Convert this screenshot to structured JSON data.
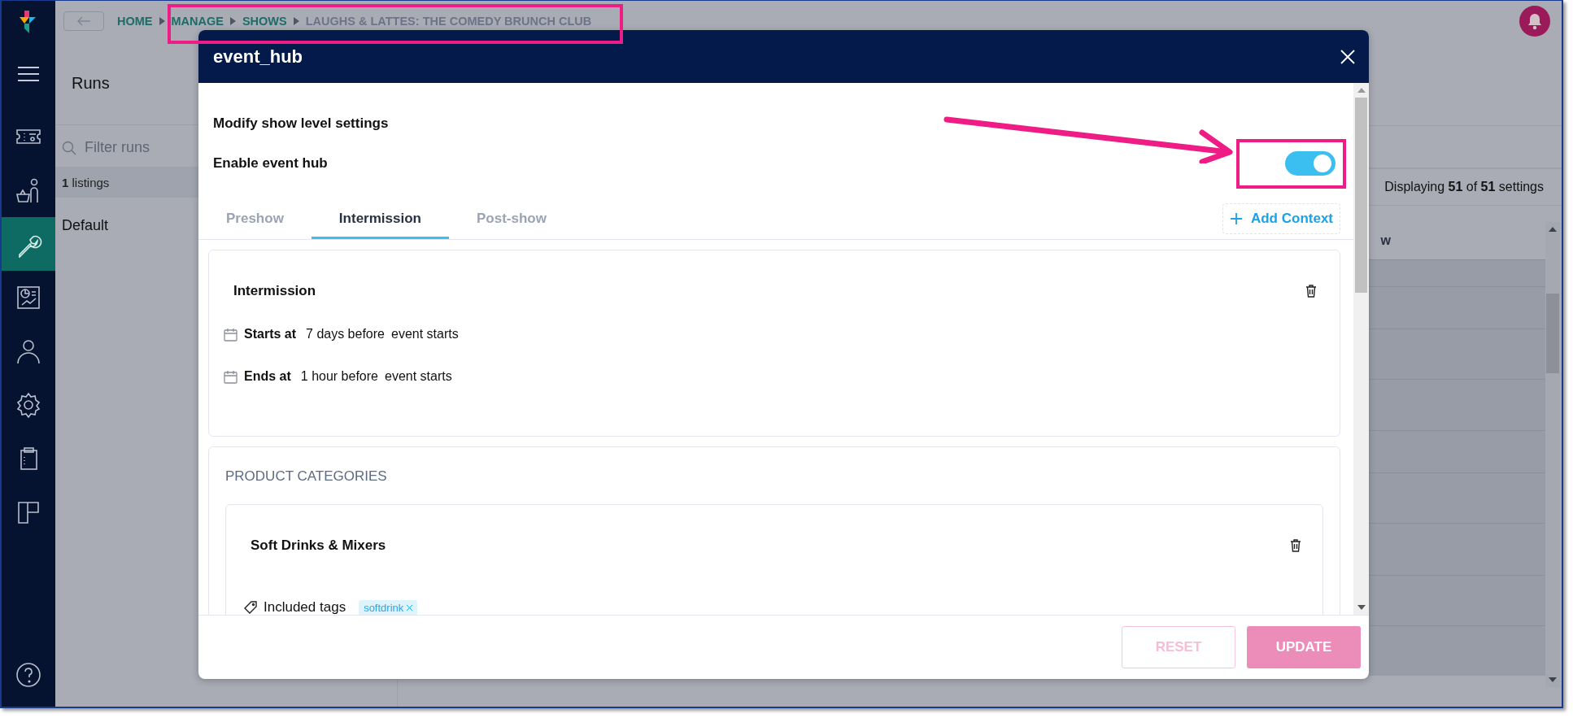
{
  "sidebar": {
    "items": [
      {
        "selected": false
      },
      {
        "selected": false
      },
      {
        "selected": true
      },
      {
        "selected": false
      },
      {
        "selected": false
      },
      {
        "selected": false
      },
      {
        "selected": false
      },
      {
        "selected": false
      },
      {
        "selected": false
      }
    ]
  },
  "breadcrumbs": [
    {
      "label": "HOME"
    },
    {
      "label": "MANAGE"
    },
    {
      "label": "SHOWS"
    },
    {
      "label": "LAUGHS & LATTES: THE COMEDY BRUNCH CLUB"
    }
  ],
  "runs_panel": {
    "title": "Runs",
    "filter_placeholder": "Filter runs",
    "listings": "**1** listings",
    "runs": [
      {
        "name": "Default"
      }
    ]
  },
  "settings_panel": {
    "displaying": "Displaying **51** of **51** settings",
    "column_header": "w"
  },
  "modal": {
    "title": "event_hub",
    "subtitle": "Modify show level settings",
    "toggle": {
      "label": "Enable event hub",
      "on": true
    },
    "tabs": [
      {
        "label": "Preshow",
        "selected": false
      },
      {
        "label": "Intermission",
        "selected": true
      },
      {
        "label": "Post-show",
        "selected": false
      }
    ],
    "add_context": "Add Context",
    "context": {
      "title": "Intermission",
      "times": [
        {
          "label": "Starts at",
          "offset": "7 days before",
          "anchor": "event starts"
        },
        {
          "label": "Ends at",
          "offset": "1 hour before",
          "anchor": "event starts"
        }
      ]
    },
    "product_categories": {
      "heading": "PRODUCT CATEGORIES",
      "categories": [
        {
          "name": "Soft Drinks & Mixers",
          "tags_label": "Included tags",
          "tags": [
            "softdrink"
          ]
        }
      ]
    },
    "buttons": [
      {
        "label": "RESET",
        "kind": "outline",
        "disabled": true
      },
      {
        "label": "UPDATE",
        "kind": "filled",
        "disabled": true
      }
    ]
  }
}
